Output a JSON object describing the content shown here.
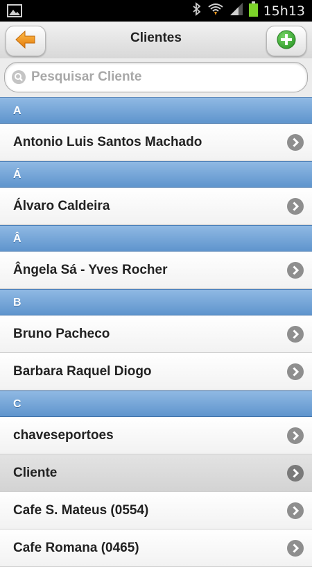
{
  "statusbar": {
    "time": "15h13"
  },
  "header": {
    "title": "Clientes",
    "back_icon": "back-arrow-icon",
    "add_icon": "add-plus-icon",
    "accent_orange": "#f39a1e",
    "accent_green": "#3fae3a"
  },
  "search": {
    "placeholder": "Pesquisar Cliente",
    "value": ""
  },
  "colors": {
    "divider": "#6fa3d8",
    "chevron": "#8e8e8e"
  },
  "sections": [
    {
      "letter": "A",
      "items": [
        "Antonio Luis Santos Machado"
      ]
    },
    {
      "letter": "Á",
      "items": [
        "Álvaro Caldeira"
      ]
    },
    {
      "letter": "Â",
      "items": [
        "Ângela Sá - Yves Rocher"
      ]
    },
    {
      "letter": "B",
      "items": [
        "Bruno Pacheco",
        "Barbara Raquel Diogo"
      ]
    },
    {
      "letter": "C",
      "items": [
        "chaveseportoes",
        "Cliente",
        "Cafe S. Mateus (0554)",
        "Cafe Romana (0465)"
      ]
    }
  ]
}
